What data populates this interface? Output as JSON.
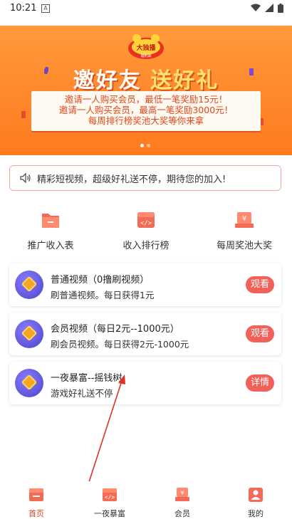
{
  "status_bar": {
    "time": "10:21",
    "sim_label": "A"
  },
  "banner": {
    "logo_text": "大独播",
    "logo_sub": "福利来",
    "headline_part1": "邀好友",
    "headline_part2": "送好礼",
    "lines": [
      "邀请一人购买会员，最低一笔奖励15元！",
      "邀请一人购买会员，最高一笔奖励3000元！",
      "每周排行榜奖池大奖等你来拿"
    ]
  },
  "notice": {
    "text": "精彩短视频，超级好礼送不停，期待您的加入!"
  },
  "quick_actions": [
    {
      "label": "推广收入表",
      "icon": "folder-icon"
    },
    {
      "label": "收入排行榜",
      "icon": "ranking-icon"
    },
    {
      "label": "每周奖池大奖",
      "icon": "prize-pool-icon"
    }
  ],
  "tasks": [
    {
      "title": "普通视频（0撸刷视频）",
      "subtitle": "刷普通视频。每日获得1元",
      "button": "观看"
    },
    {
      "title": "会员视频（每日2元--1000元）",
      "subtitle": "刷会员视频。每日获得2元-1000元",
      "button": "观看"
    },
    {
      "title": "一夜暴富--摇钱树",
      "subtitle": "游戏好礼送不停",
      "button": "详情"
    }
  ],
  "tab_bar": [
    {
      "label": "首页",
      "active": true
    },
    {
      "label": "一夜暴富",
      "active": false
    },
    {
      "label": "会员",
      "active": false
    },
    {
      "label": "我的",
      "active": false
    }
  ],
  "colors": {
    "accent": "#f1615a",
    "banner": "#ff8a2a",
    "tab_active": "#e2461b"
  }
}
